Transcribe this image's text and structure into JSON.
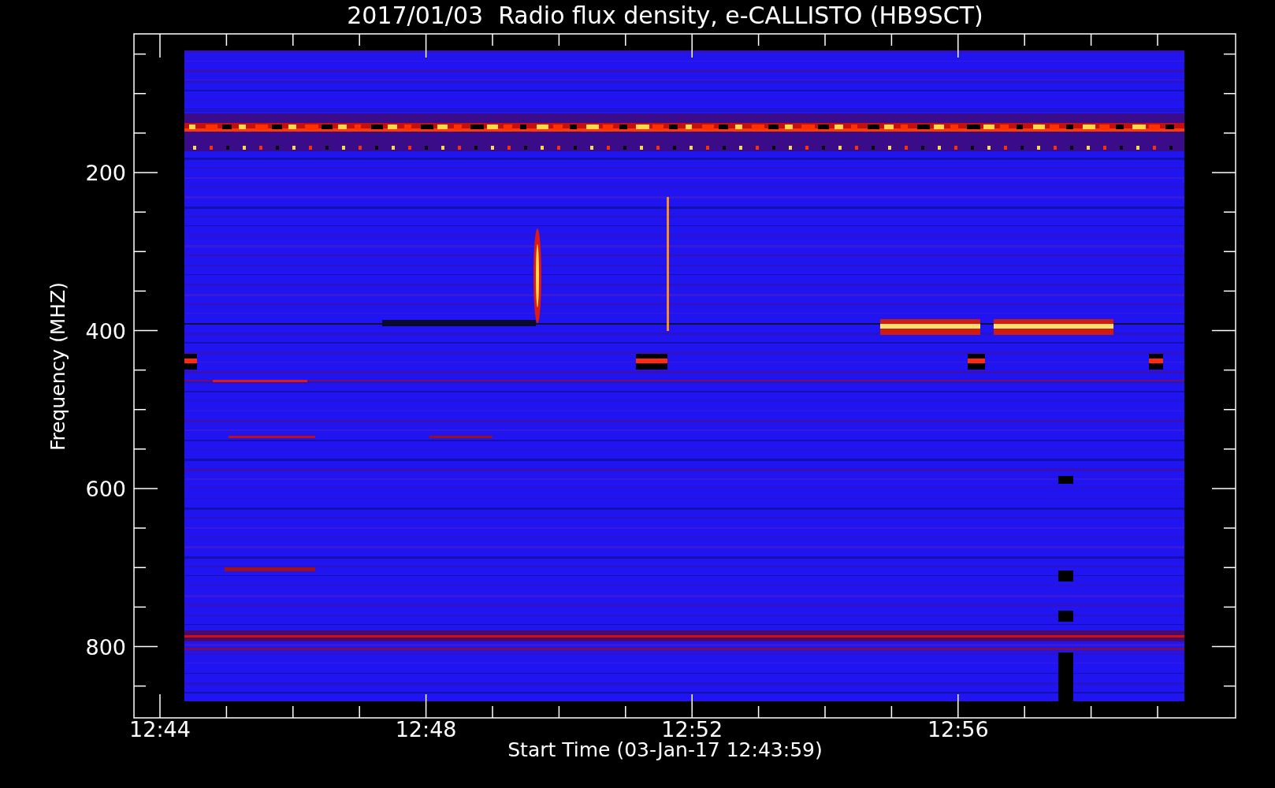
{
  "title": "2017/01/03  Radio flux density, e-CALLISTO (HB9SCT)",
  "plot": {
    "y_axis": {
      "label": "Frequency (MHZ)",
      "ticks": [
        "200",
        "400",
        "600",
        "800"
      ]
    },
    "x_axis": {
      "label": "Start Time (03-Jan-17 12:43:59)",
      "ticks": [
        "12:44",
        "12:48",
        "12:52",
        "12:56"
      ]
    }
  }
}
